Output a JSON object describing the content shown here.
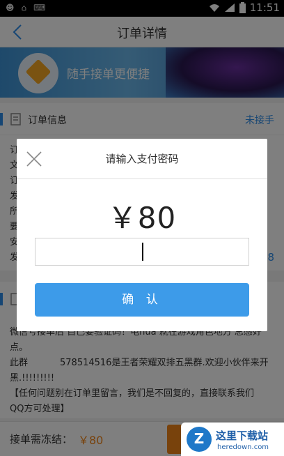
{
  "status_bar": {
    "time": "11:51"
  },
  "nav": {
    "title": "订单详情"
  },
  "banner": {
    "slogan": "随手接单更便捷"
  },
  "order_info": {
    "title": "订单信息",
    "status": "未接手",
    "left_chars": [
      "订",
      "文",
      "订",
      "发",
      "所",
      "要",
      "安",
      "发"
    ],
    "right_digit": "8"
  },
  "notes": {
    "line1": "微信号接单后 自己要验证码！电huà 就在游戏角色地方 总感好",
    "line2": "点。",
    "qq_prefix": "此群",
    "qq_text": "578514516是王者荣耀双排五黑群.欢迎小伙伴来开",
    "line4": "黑.!!!!!!!!!",
    "line5": "【任何问题别在订单里留言，我们是不回复的，直接联系我们",
    "line6": "QQ方可处理】"
  },
  "bottom_bar": {
    "freeze_label": "接单需冻结：",
    "freeze_amount": "￥80"
  },
  "dialog": {
    "title": "请输入支付密码",
    "amount": "￥80",
    "password_value": "",
    "confirm_label": "确 认"
  },
  "watermark": {
    "title": "这里下载站",
    "url": "heredown.com",
    "logo_letter": "Z"
  },
  "colors": {
    "accent_blue": "#3d9be9",
    "accent_orange": "#f08519"
  }
}
